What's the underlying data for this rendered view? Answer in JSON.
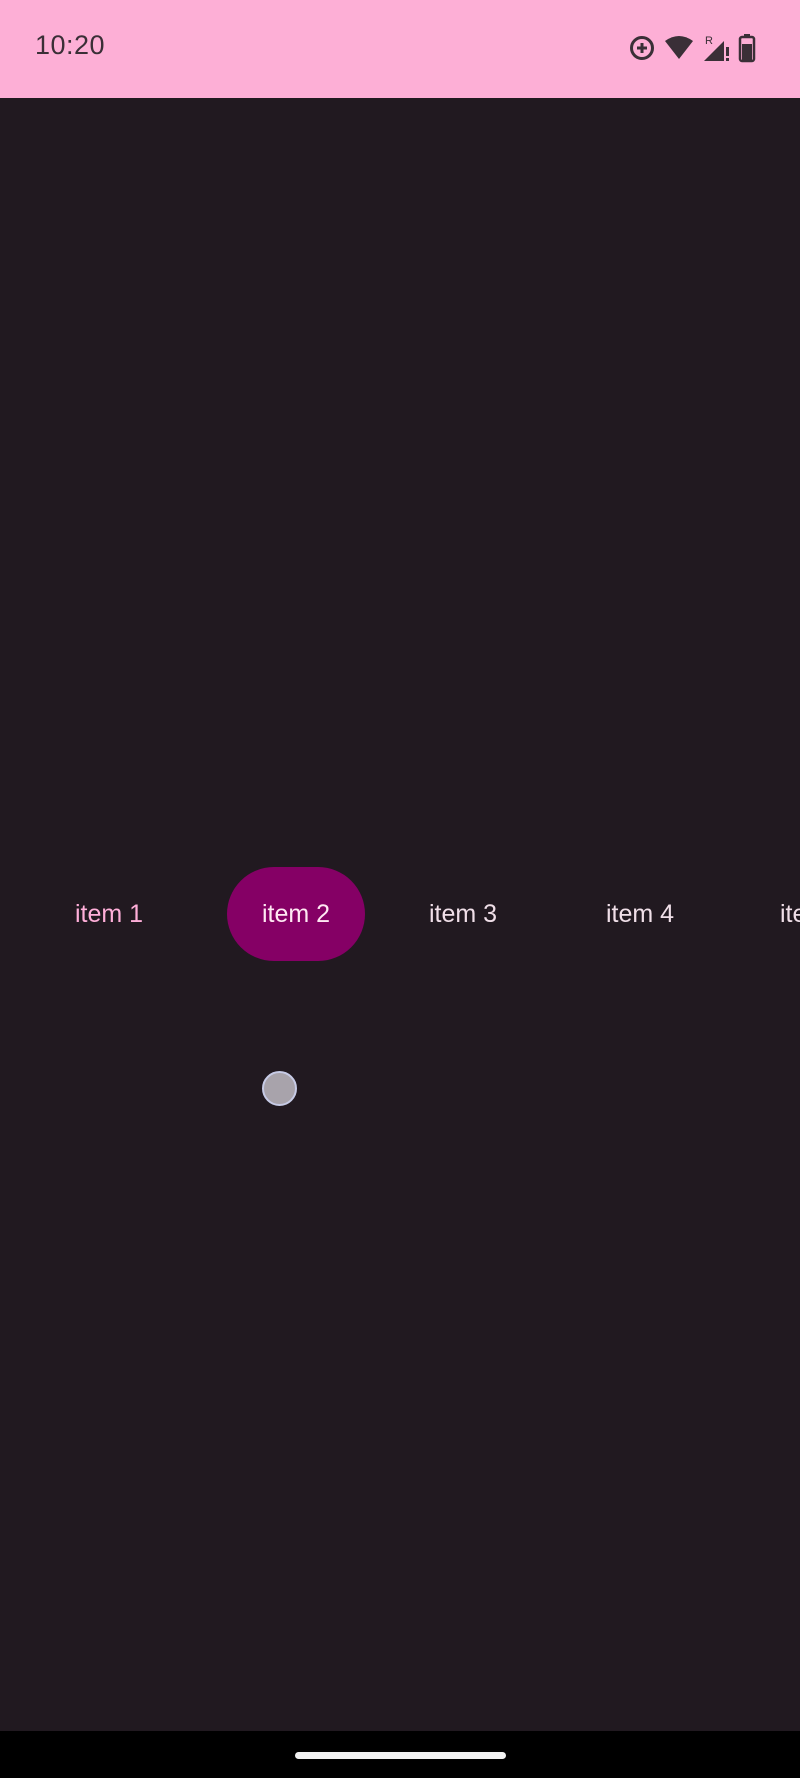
{
  "status_bar": {
    "time": "10:20",
    "icons": [
      "data-saver-icon",
      "wifi-icon",
      "signal-roaming-icon",
      "battery-icon"
    ],
    "roaming_label": "R",
    "background": "#fdafd6"
  },
  "tabs": [
    {
      "label": "item 1",
      "selected": false
    },
    {
      "label": "item 2",
      "selected": true
    },
    {
      "label": "item 3",
      "selected": false
    },
    {
      "label": "item 4",
      "selected": false
    },
    {
      "label": "ite",
      "selected": false
    }
  ],
  "colors": {
    "background": "#211920",
    "selected_tab": "#850065",
    "tab_text_accent": "#ffafd9"
  }
}
